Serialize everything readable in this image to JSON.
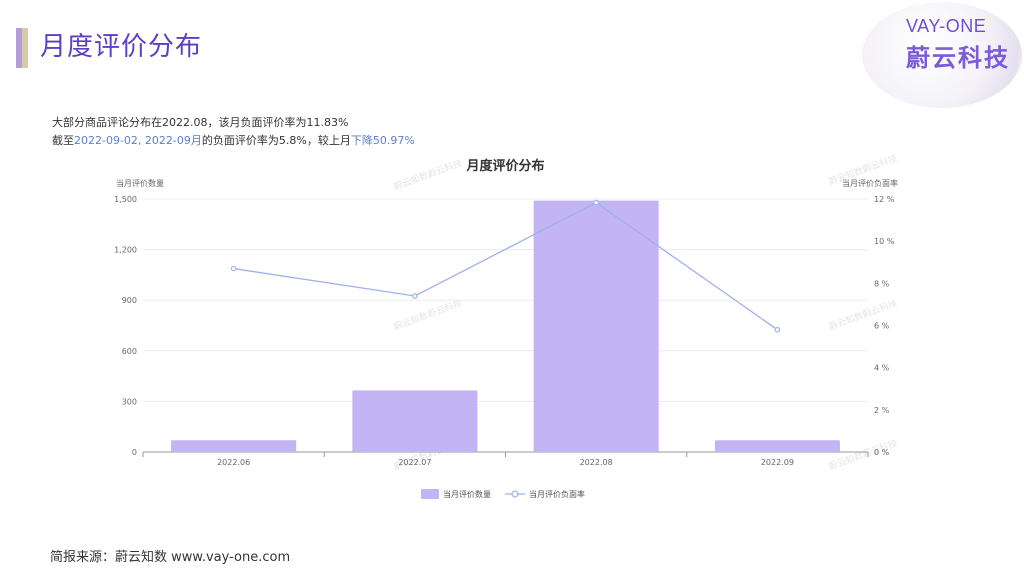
{
  "page": {
    "title": "月度评价分布",
    "logo_en": "VAY-ONE",
    "logo_cn": "蔚云科技",
    "summary_line1": "大部分商品评论分布在2022.08，该月负面评价率为11.83%",
    "summary_line2_prefix": "截至",
    "summary_line2_period": "2022-09-02, 2022-09月",
    "summary_line2_middle": "的负面评价率为5.8%，较上月",
    "summary_line2_change": "下降50.97%",
    "source": "简报来源：蔚云知数 www.vay-one.com"
  },
  "chart_data": {
    "type": "bar",
    "title": "月度评价分布",
    "categories": [
      "2022.06",
      "2022.07",
      "2022.08",
      "2022.09"
    ],
    "series": [
      {
        "name": "当月评价数量",
        "type": "bar",
        "axis": "left",
        "values": [
          70,
          365,
          1490,
          70
        ],
        "color": "#c3b4f4"
      },
      {
        "name": "当月评价负面率",
        "type": "line",
        "axis": "right",
        "values": [
          8.7,
          7.4,
          11.83,
          5.8
        ],
        "color": "#9fb0ee"
      }
    ],
    "ylabel": "当月评价数量",
    "ylabel_right": "当月评价负面率",
    "ylim": [
      0,
      1500
    ],
    "yticks": [
      "0",
      "300",
      "600",
      "900",
      "1,200",
      "1,500"
    ],
    "ylim_right": [
      0,
      12
    ],
    "yticks_right": [
      "0 %",
      "2 %",
      "4 %",
      "6 %",
      "8 %",
      "10 %",
      "12 %"
    ],
    "legend": "bottom-center",
    "grid": true,
    "watermark": "蔚云知数蔚云科技"
  }
}
